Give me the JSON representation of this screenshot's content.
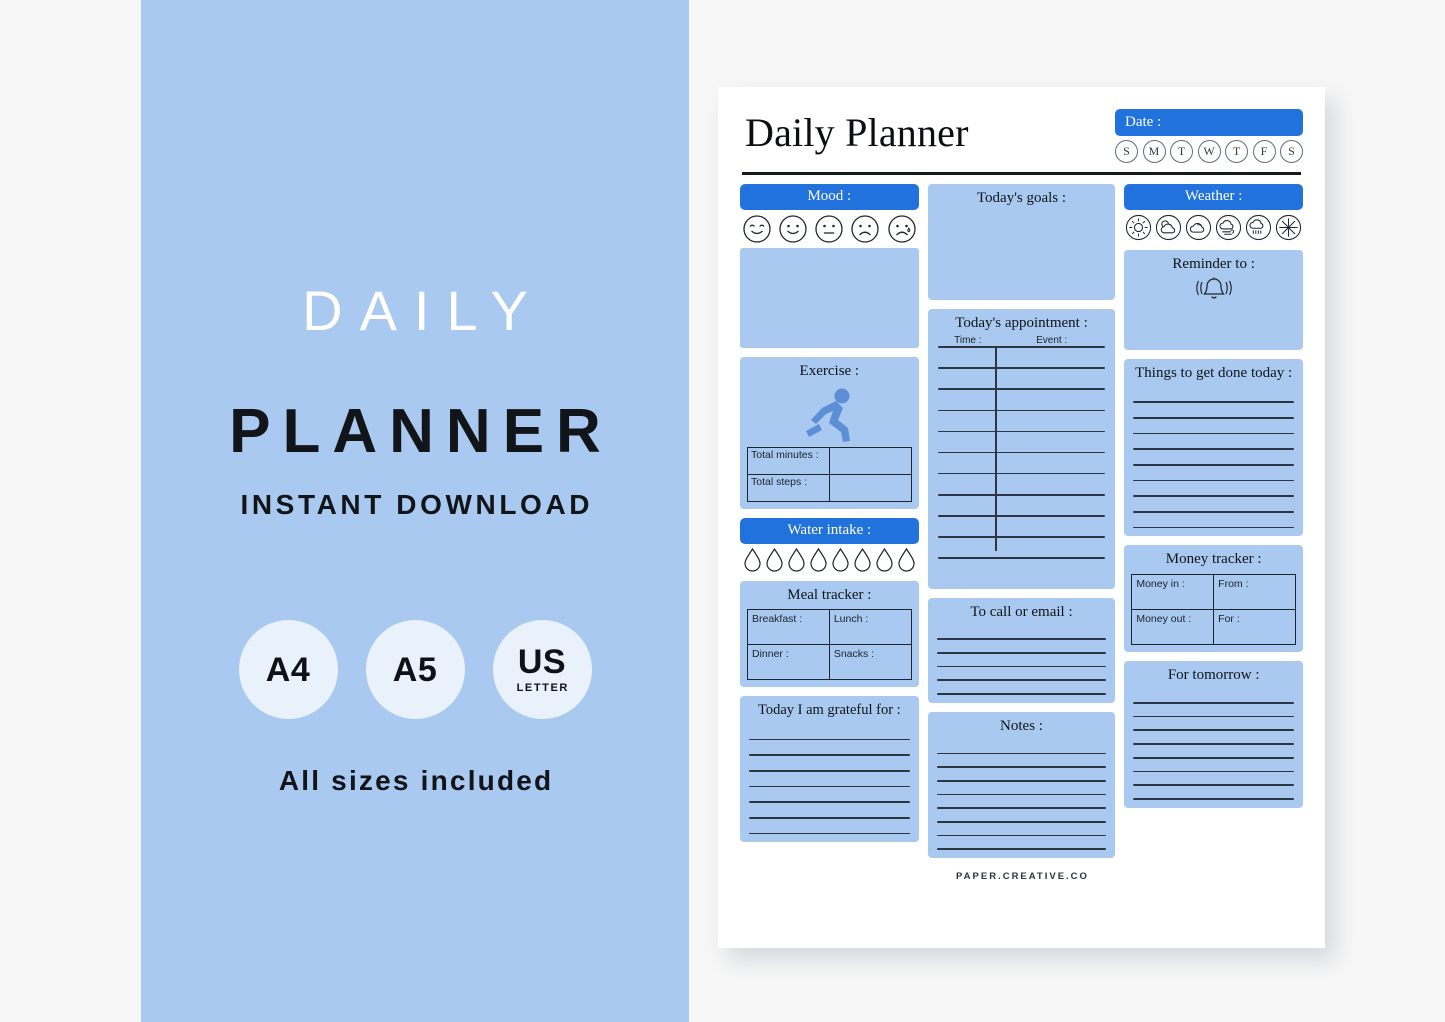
{
  "promo": {
    "title": "DAILY",
    "subtitle": "PLANNER",
    "tagline": "INSTANT DOWNLOAD",
    "badges": [
      {
        "main": "A4",
        "sub": ""
      },
      {
        "main": "A5",
        "sub": ""
      },
      {
        "main": "US",
        "sub": "LETTER"
      }
    ],
    "footer": "All sizes included",
    "background_color": "#a9c9f0"
  },
  "planner": {
    "title": "Daily Planner",
    "date": {
      "label": "Date :",
      "days": [
        "S",
        "M",
        "T",
        "W",
        "T",
        "F",
        "S"
      ]
    },
    "mood": {
      "label": "Mood :",
      "faces": [
        "happy-closed-eyes-face",
        "smiling-face",
        "neutral-face",
        "sad-face",
        "crying-face"
      ]
    },
    "goals": {
      "label": "Today's goals :"
    },
    "weather": {
      "label": "Weather :",
      "icons": [
        "sun-icon",
        "sun-cloud-icon",
        "cloud-icon",
        "wind-cloud-icon",
        "rain-cloud-icon",
        "snowflake-icon"
      ]
    },
    "reminder": {
      "label": "Reminder to :",
      "icon": "bell-icon"
    },
    "exercise": {
      "label": "Exercise :",
      "icon": "running-person-icon",
      "rows": [
        {
          "label": "Total minutes :",
          "value": ""
        },
        {
          "label": "Total steps :",
          "value": ""
        }
      ]
    },
    "appointment": {
      "label": "Today's appointment :",
      "columns": [
        "Time :",
        "Event :"
      ],
      "line_count": 11
    },
    "things_to_do": {
      "label": "Things to get done today :",
      "line_count": 9
    },
    "water": {
      "label": "Water intake :",
      "drop_count": 8
    },
    "meal_tracker": {
      "label": "Meal tracker :",
      "cells": [
        "Breakfast :",
        "Lunch :",
        "Dinner :",
        "Snacks :"
      ]
    },
    "call_or_email": {
      "label": "To call or email :",
      "line_count": 5
    },
    "money_tracker": {
      "label": "Money tracker :",
      "cells": [
        "Money in :",
        "From :",
        "Money out :",
        "For :"
      ]
    },
    "grateful": {
      "label": "Today I am grateful for :",
      "line_count": 7
    },
    "notes": {
      "label": "Notes :",
      "line_count": 8
    },
    "tomorrow": {
      "label": "For tomorrow :",
      "line_count": 8
    },
    "footer": "PAPER.CREATIVE.CO",
    "accent_color": "#2172dd",
    "card_color": "#a9c9f0"
  }
}
